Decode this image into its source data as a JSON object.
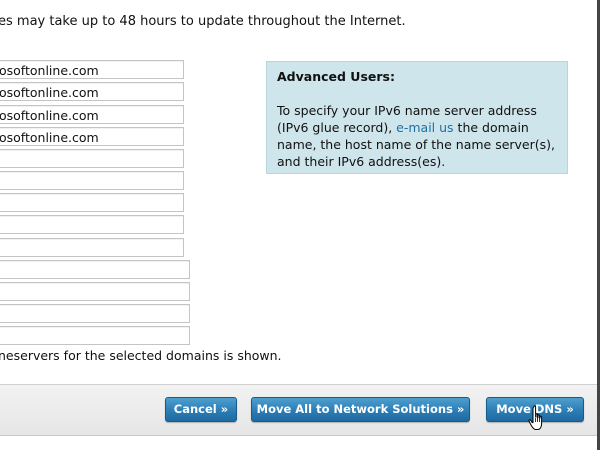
{
  "notice": "es may take up to 48 hours to update throughout the Internet.",
  "nameservers": [
    "osoftonline.com",
    "osoftonline.com",
    "osoftonline.com",
    "osoftonline.com",
    "",
    "",
    "",
    "",
    "",
    "",
    "",
    "",
    ""
  ],
  "advanced": {
    "title": "Advanced Users:",
    "text_before_link": "To specify your IPv6 name server address (IPv6 glue record), ",
    "link": "e-mail us",
    "text_after_link": " the domain name, the host name of the name server(s), and their IPv6 address(es)."
  },
  "footnote": "neservers for the selected domains is shown.",
  "buttons": {
    "cancel": "Cancel »",
    "move_all": "Move All to Network Solutions »",
    "move_dns": "Move DNS »"
  },
  "colors": {
    "button_blue": "#2f80b8",
    "panel_bg": "#cfe5ec",
    "link": "#1e6fa4"
  },
  "icons": {
    "pointer": "hand-pointer-icon"
  }
}
